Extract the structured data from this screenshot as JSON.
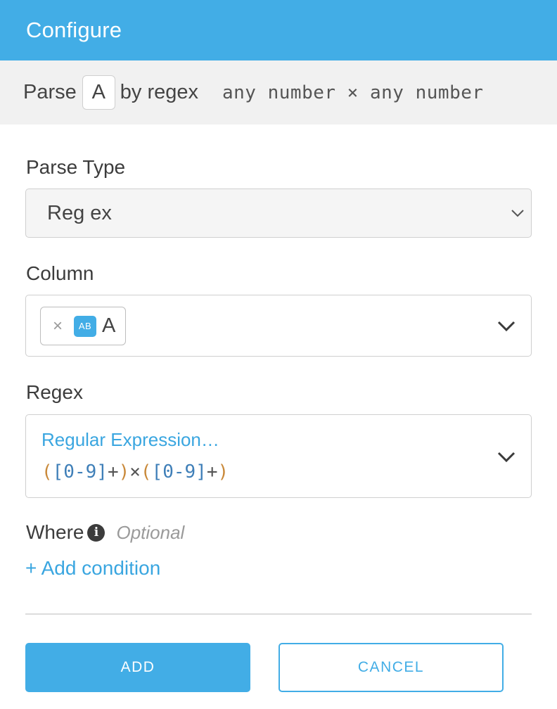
{
  "header": {
    "title": "Configure"
  },
  "summary": {
    "prefix": "Parse",
    "column_chip": "A",
    "middle": "by regex",
    "pattern_description": "any number × any number"
  },
  "parse_type": {
    "label": "Parse Type",
    "value": "Reg ex"
  },
  "column": {
    "label": "Column",
    "selected": {
      "remove": "×",
      "type_badge": "AB",
      "name": "A"
    }
  },
  "regex": {
    "label": "Regex",
    "placeholder": "Regular Expression…",
    "tokens": [
      "(",
      "[0-9]",
      "+",
      ")",
      "×",
      "(",
      "[0-9]",
      "+",
      ")"
    ]
  },
  "where": {
    "label": "Where",
    "info_icon": "i",
    "optional": "Optional",
    "add_condition": "+ Add condition"
  },
  "buttons": {
    "add": "ADD",
    "cancel": "CANCEL"
  },
  "colors": {
    "accent": "#42ade6",
    "summary_bg": "#f1f1f1",
    "regex_paren": "#c9893a",
    "regex_class": "#3f7fb8"
  }
}
